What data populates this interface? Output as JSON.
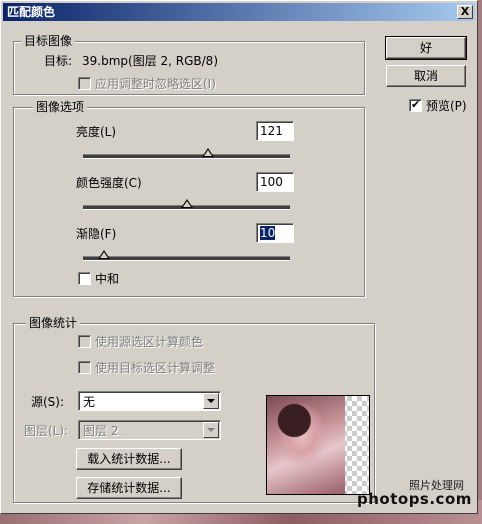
{
  "window": {
    "title": "匹配颜色",
    "close_label": "X"
  },
  "target_group": {
    "legend": "目标图像",
    "target_label": "目标:",
    "target_value": "39.bmp(图层 2, RGB/8)",
    "ignore_selection": {
      "label": "应用调整时忽略选区(I)",
      "checked": false,
      "enabled": false
    }
  },
  "options_group": {
    "legend": "图像选项",
    "luminance": {
      "label": "亮度(L)",
      "value": "121",
      "level": 0.605
    },
    "color_intensity": {
      "label": "颜色强度(C)",
      "value": "100",
      "level": 0.5
    },
    "fade": {
      "label": "渐隐(F)",
      "value": "10",
      "level": 0.1
    },
    "neutralize": {
      "label": "中和",
      "checked": false
    }
  },
  "buttons": {
    "ok": "好",
    "cancel": "取消"
  },
  "preview": {
    "label": "预览(P)",
    "checked": true
  },
  "stats_group": {
    "legend": "图像统计",
    "use_source_selection": {
      "label": "使用源选区计算颜色",
      "checked": false,
      "enabled": false
    },
    "use_target_selection": {
      "label": "使用目标选区计算调整",
      "checked": false,
      "enabled": false
    },
    "source": {
      "label": "源(S):",
      "value": "无"
    },
    "layer": {
      "label": "图层(L):",
      "value": "图层 2"
    },
    "load_button": "载入统计数据...",
    "save_button": "存储统计数据..."
  },
  "watermark": {
    "text1": "照片处理网",
    "text2": "photops.com"
  }
}
